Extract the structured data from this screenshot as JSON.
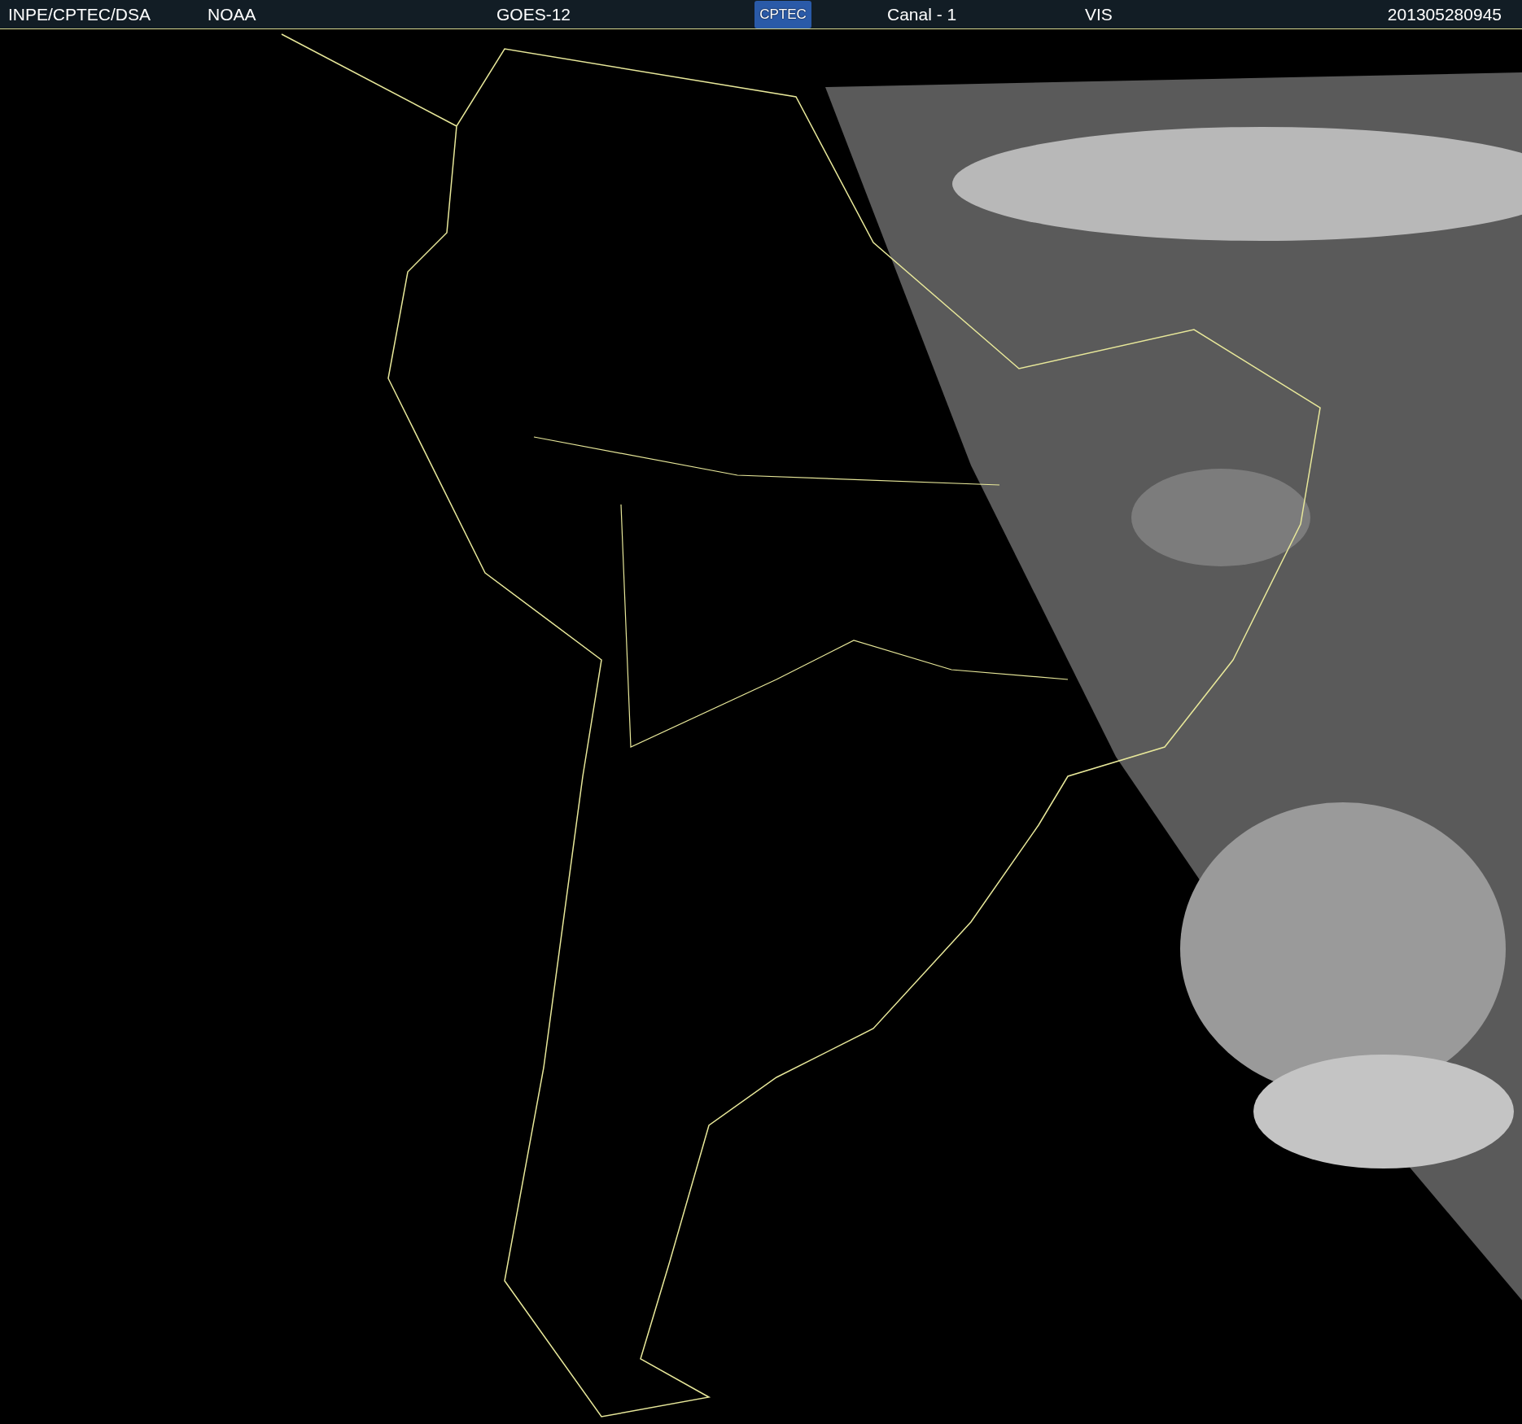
{
  "header": {
    "source": "INPE/CPTEC/DSA",
    "agency": "NOAA",
    "satellite": "GOES-12",
    "logo_text": "CPTEC",
    "channel": "Canal - 1",
    "band": "VIS",
    "timestamp": "201305280945"
  }
}
